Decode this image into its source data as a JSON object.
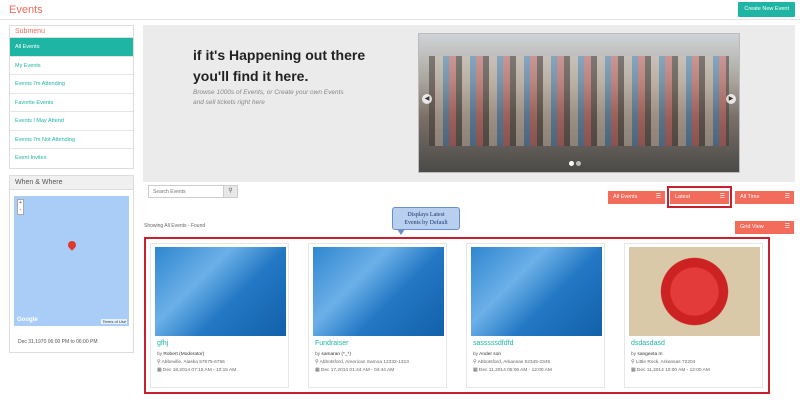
{
  "header": {
    "title": "Events",
    "create_button": "Create New Event"
  },
  "submenu": {
    "title": "Submenu",
    "items": [
      {
        "label": "All Events",
        "active": true
      },
      {
        "label": "My Events",
        "active": false
      },
      {
        "label": "Events I'm Attending",
        "active": false
      },
      {
        "label": "Favorite Events",
        "active": false
      },
      {
        "label": "Events I May Attend",
        "active": false
      },
      {
        "label": "Events I'm Not Attending",
        "active": false
      },
      {
        "label": "Event Invites",
        "active": false
      }
    ]
  },
  "when_where": {
    "title": "When & Where",
    "map_brand": "Google",
    "map_terms": "Terms of Use",
    "zoom_in": "+",
    "zoom_out": "-",
    "date_range": "Dec 31,1970 06:00 PM to 06:00 PM"
  },
  "hero": {
    "headline_1": "if it's Happening out there",
    "headline_2": "you'll find it here.",
    "subtext": "Browse 1000s of Events, or Create your own Events and sell tickets right here"
  },
  "filters": {
    "search_placeholder": "Search Events",
    "all_events": "All Events",
    "latest": "Latest",
    "all_time": "All Time",
    "grid_view": "Grid View",
    "showing": "Showing All Events - Found"
  },
  "callout": {
    "line1": "Displays Latest",
    "line2": "Events by Default"
  },
  "events": [
    {
      "name": "gfhj",
      "by_prefix": "by",
      "host": "Robert (Moderator)",
      "location": "Abbeville, Alaska 57675-6756",
      "datetime": "Dec 18,2014 07:15 AM - 10:15 AM",
      "image": "blue"
    },
    {
      "name": "Fundraiser",
      "by_prefix": "by",
      "host": "samaran (*_*)",
      "location": "Abbotsford, American Samoa 12332-1313",
      "datetime": "Dec 17,2014 01:44 AM - 04:44 AM",
      "image": "blue"
    },
    {
      "name": "sasssssdfdfd",
      "by_prefix": "by",
      "host": "Ander son",
      "location": "Abbotsford, Arkansas 52345-2345",
      "datetime": "Dec 11,2014 05:06 AM - 12:00 AM",
      "image": "blue"
    },
    {
      "name": "dsdasdasd",
      "by_prefix": "by",
      "host": "sangeeta m",
      "location": "Little Rock, Arkansas 72204",
      "datetime": "Dec 11,2014 10:00 AM - 12:00 AM",
      "image": "photo"
    }
  ],
  "colors": {
    "accent": "#f26b5b",
    "teal": "#1fb5a4",
    "highlight": "#c8202f"
  }
}
